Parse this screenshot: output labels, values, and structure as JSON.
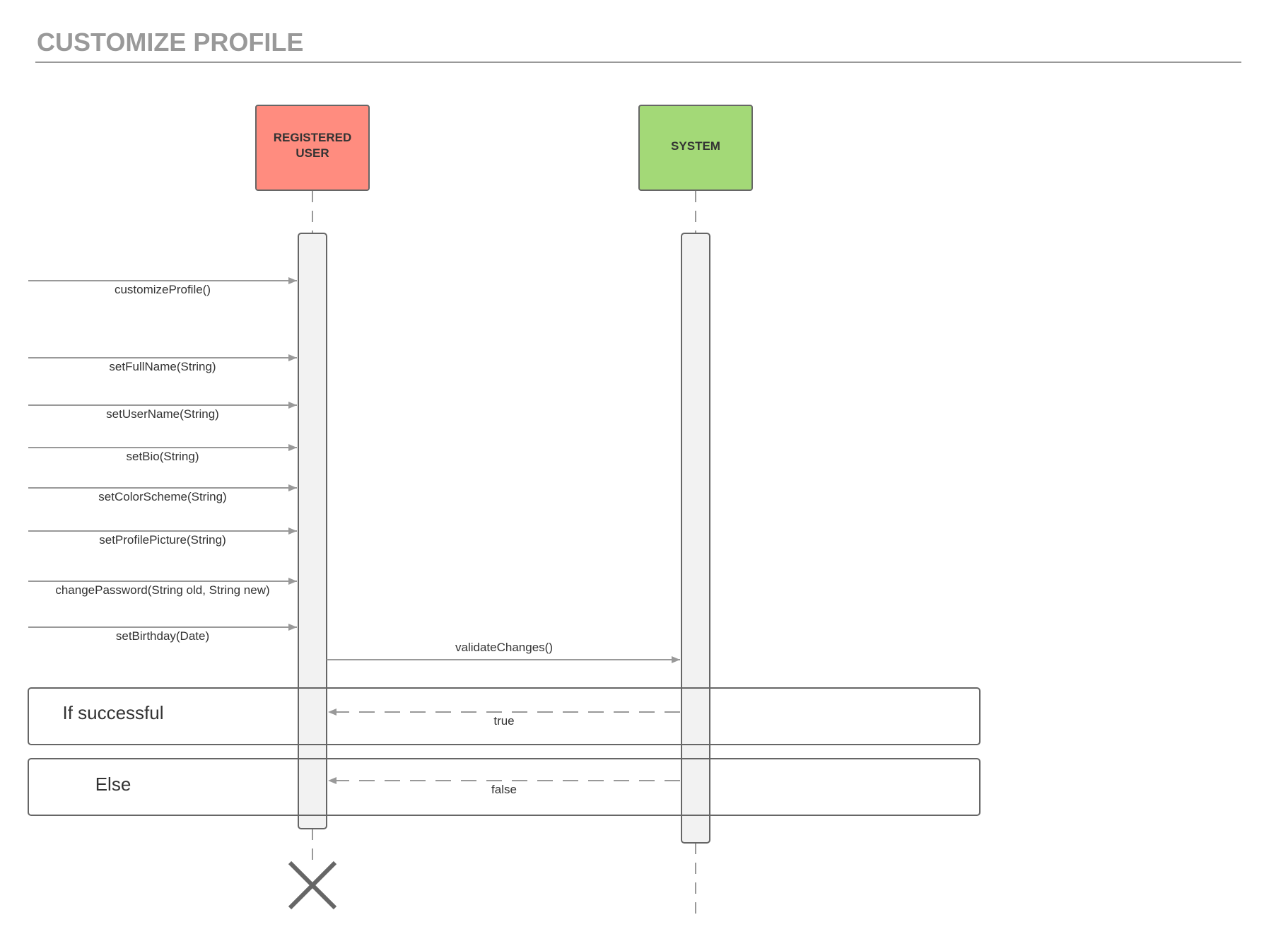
{
  "title": "CUSTOMIZE PROFILE",
  "colors": {
    "registered_user": "#FF8C7F",
    "system": "#A3D977",
    "activation": "#F2F2F2",
    "line": "#999999",
    "outline": "#666666",
    "title": "#999999",
    "text": "#333333"
  },
  "actors": [
    {
      "id": "user",
      "name_lines": [
        "REGISTERED",
        "USER"
      ]
    },
    {
      "id": "system",
      "name_lines": [
        "SYSTEM"
      ]
    }
  ],
  "incoming_messages": [
    "customizeProfile()",
    "setFullName(String)",
    "setUserName(String)",
    "setBio(String)",
    "setColorScheme(String)",
    "setProfilePicture(String)",
    "changePassword(String old, String new)",
    "setBirthday(Date)"
  ],
  "validate_message": "validateChanges()",
  "frames": [
    {
      "label": "If successful",
      "return_label": "true"
    },
    {
      "label": "Else",
      "return_label": "false"
    }
  ]
}
